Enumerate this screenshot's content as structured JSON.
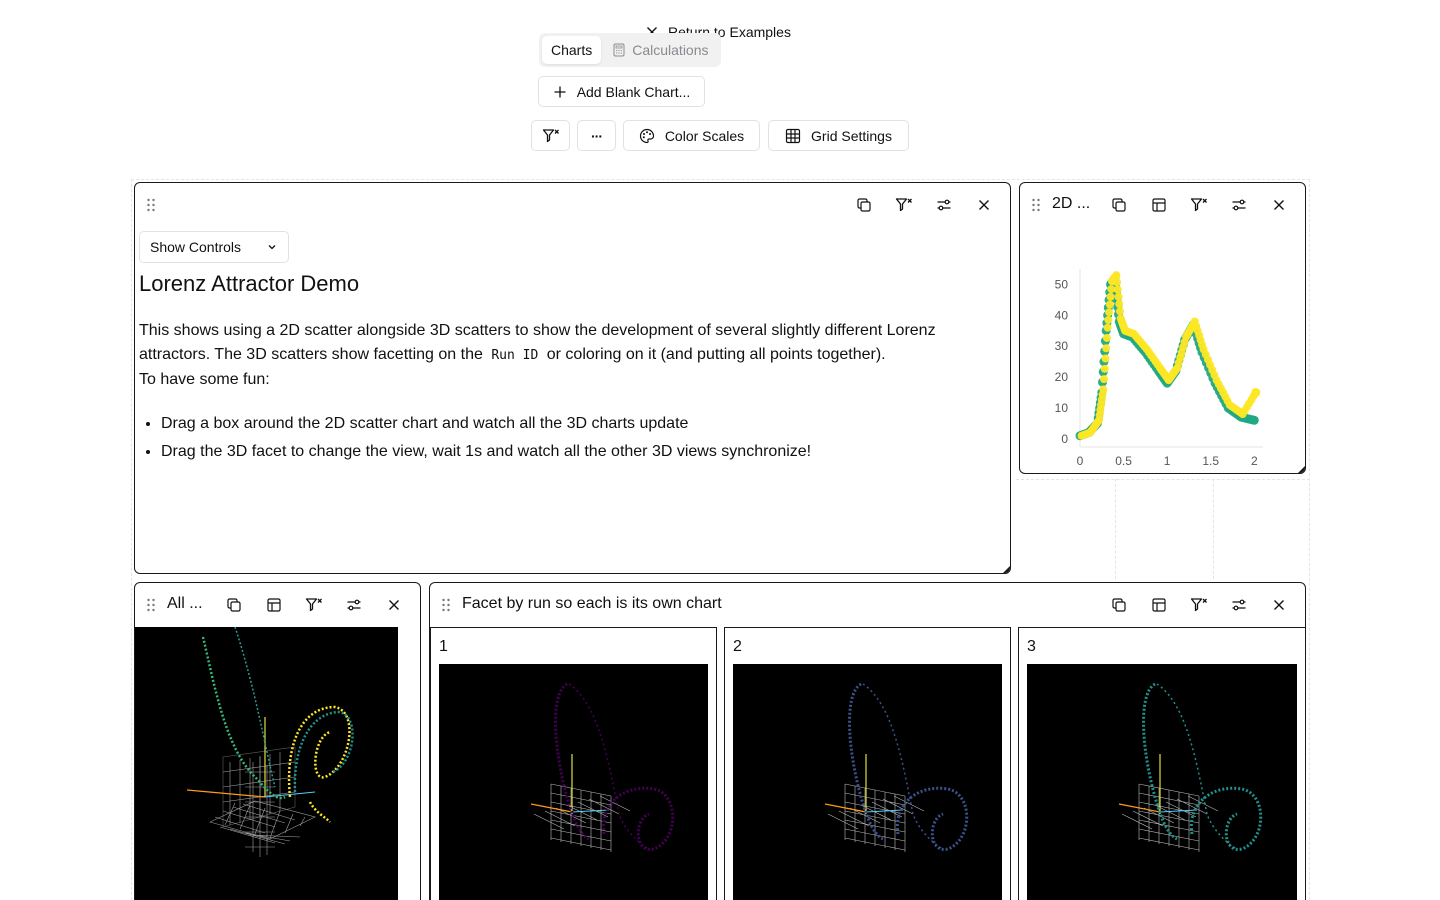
{
  "nav": {
    "return_label": "Return to Examples",
    "tabs": [
      {
        "label": "Charts",
        "active": true
      },
      {
        "label": "Calculations",
        "active": false
      }
    ]
  },
  "toolbar": {
    "add_blank_label": "Add Blank Chart...",
    "more_label": "···",
    "color_scales_label": "Color Scales",
    "grid_settings_label": "Grid Settings"
  },
  "markdown_panel": {
    "show_controls_label": "Show Controls",
    "heading": "Lorenz Attractor Demo",
    "para1_a": "This shows using a 2D scatter alongside 3D scatters to show the development of several slightly different Lorenz attractors. The 3D scatters show facetting on the",
    "para1_code": "Run ID",
    "para1_b": "or coloring on it (and putting all points together).",
    "para2": "To have some fun:",
    "bullets": [
      "Drag a box around the 2D scatter chart and watch all the 3D charts update",
      "Drag the 3D facet to change the view, wait 1s and watch all the other 3D views synchronize!"
    ]
  },
  "scatter2d_panel": {
    "title": "2D ...",
    "chart_data": {
      "type": "scatter",
      "x_ticks": [
        "0",
        "0.5",
        "1",
        "1.5",
        "2"
      ],
      "y_ticks": [
        "0",
        "10",
        "20",
        "30",
        "40",
        "50"
      ],
      "xlim": [
        0,
        2.1
      ],
      "ylim": [
        -2,
        55
      ],
      "series": [
        {
          "color": "#21a884",
          "x": [
            0,
            0.1,
            0.2,
            0.25,
            0.3,
            0.35,
            0.4,
            0.45,
            0.5,
            0.6,
            0.75,
            0.9,
            1.0,
            1.1,
            1.2,
            1.3,
            1.4,
            1.55,
            1.7,
            1.85,
            2.0
          ],
          "y": [
            1,
            2,
            5,
            15,
            35,
            50,
            52,
            38,
            34,
            33,
            28,
            22,
            18,
            22,
            32,
            37,
            28,
            18,
            10,
            7,
            6
          ]
        },
        {
          "color": "#fde725",
          "x": [
            0,
            0.1,
            0.2,
            0.25,
            0.3,
            0.35,
            0.4,
            0.45,
            0.5,
            0.6,
            0.75,
            0.9,
            1.0,
            1.1,
            1.2,
            1.3,
            1.4,
            1.55,
            1.7,
            1.85,
            2.0
          ],
          "y": [
            1,
            2,
            6,
            16,
            36,
            51,
            53,
            39,
            35,
            34,
            29,
            23,
            19,
            23,
            33,
            38,
            29,
            19,
            11,
            8,
            15
          ]
        }
      ]
    }
  },
  "all_panel": {
    "title": "All ..."
  },
  "facet_panel": {
    "title": "Facet by run so each is its own chart",
    "facets": [
      {
        "label": "1",
        "color": "#440154"
      },
      {
        "label": "2",
        "color": "#3b528b"
      },
      {
        "label": "3",
        "color": "#21918c"
      }
    ]
  },
  "colors": {
    "border": "#1a1a1a",
    "muted": "#8a8a8f",
    "viridis_yellow": "#fde725",
    "viridis_green": "#21a884"
  }
}
